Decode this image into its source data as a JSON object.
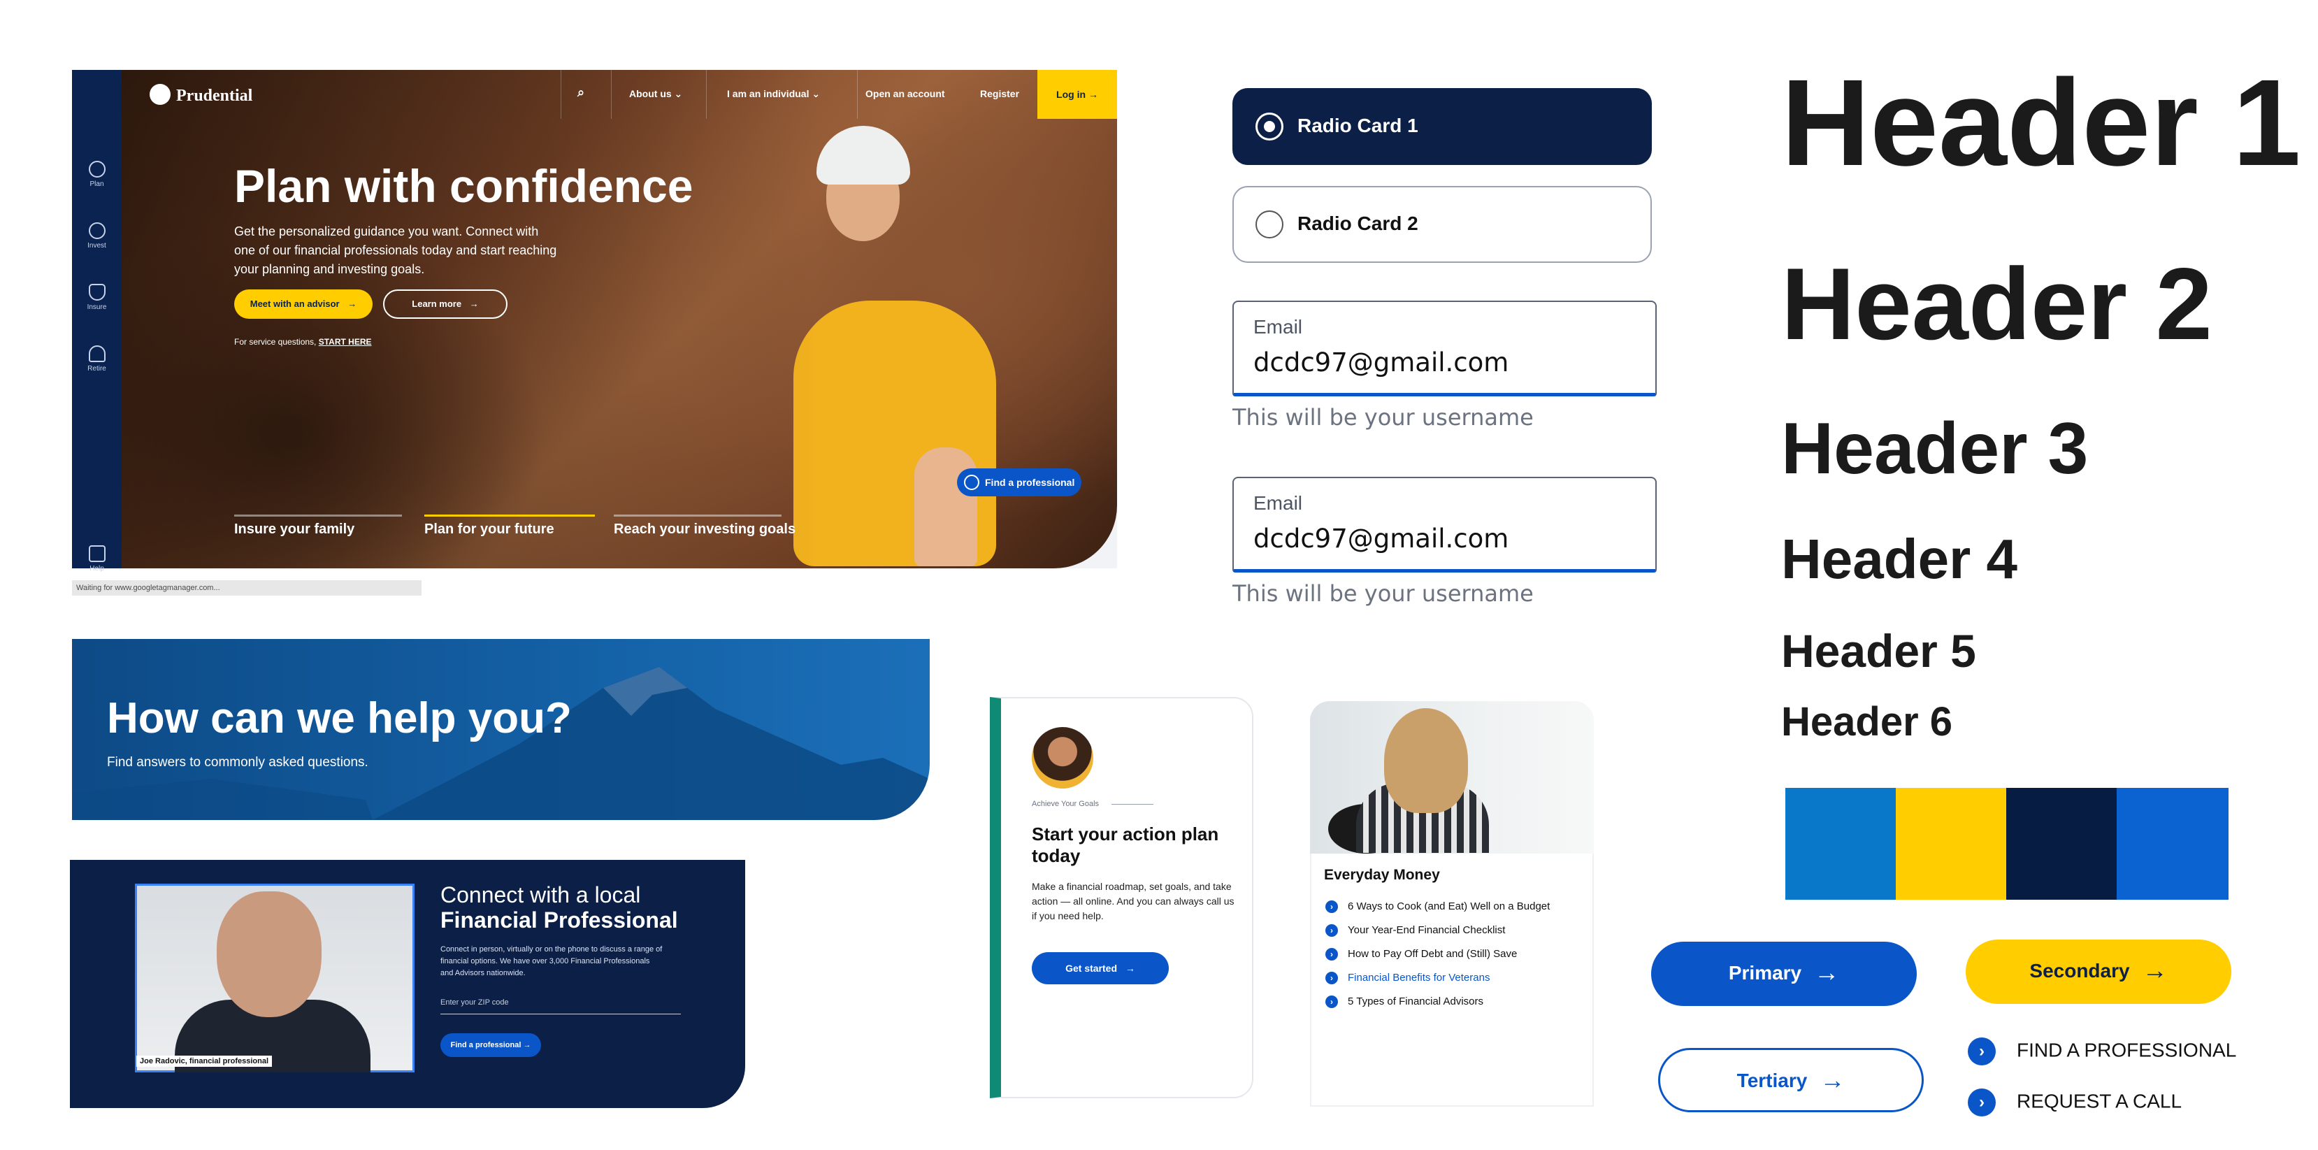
{
  "hero": {
    "rail_items": [
      "Plan",
      "Invest",
      "Insure",
      "Retire",
      "Help"
    ],
    "logo": "Prudential",
    "nav": [
      "About us",
      "I am an individual",
      "Open an account",
      "Register",
      "Log in"
    ],
    "title": "Plan with confidence",
    "body": "Get the personalized guidance you want. Connect with one of our financial professionals today and start reaching your planning and investing goals.",
    "primary_cta": "Meet with an advisor",
    "secondary_cta": "Learn more",
    "note_prefix": "For service questions,",
    "note_link": "START HERE",
    "tabs": [
      "Insure your family",
      "Plan for your future",
      "Reach your investing goals"
    ],
    "find_pro": "Find a professional",
    "status": "Waiting for www.googletagmanager.com..."
  },
  "radios": [
    {
      "label": "Radio Card 1",
      "selected": true
    },
    {
      "label": "Radio Card 2",
      "selected": false
    }
  ],
  "fields": [
    {
      "label": "Email",
      "value": "dcdc97@gmail.com",
      "helper": "This will be your username"
    },
    {
      "label": "Email",
      "value": "dcdc97@gmail.com",
      "helper": "This will be your username"
    }
  ],
  "headers": [
    "Header 1",
    "Header 2",
    "Header 3",
    "Header 4",
    "Header 5",
    "Header 6"
  ],
  "palette": [
    "#0a78c9",
    "#ffcd00",
    "#061c42",
    "#0a63d1"
  ],
  "buttons": {
    "primary": "Primary",
    "secondary": "Secondary",
    "tertiary": "Tertiary",
    "link1": "FIND A PROFESSIONAL",
    "link2": "REQUEST A CALL"
  },
  "help_banner": {
    "title": "How can we help you?",
    "subtitle": "Find answers to commonly asked questions."
  },
  "connect": {
    "title_line1": "Connect with a local",
    "title_line2": "Financial Professional",
    "body": "Connect in person, virtually or on the phone to discuss a range of financial options. We have over 3,000 Financial Professionals and Advisors nationwide.",
    "zip_placeholder": "Enter your ZIP code",
    "button": "Find a professional",
    "name_tag": "Joe Radovic, financial professional"
  },
  "action_card": {
    "eyebrow": "Achieve Your Goals",
    "title": "Start your action plan today",
    "body": "Make a financial roadmap, set goals, and take action — all online. And you can always call us if you need help.",
    "button": "Get started"
  },
  "money_card": {
    "title": "Everyday Money",
    "items": [
      "6 Ways to Cook (and Eat) Well on a Budget",
      "Your Year-End Financial Checklist",
      "How to Pay Off Debt and (Still) Save",
      "Financial Benefits for Veterans",
      "5 Types of Financial Advisors"
    ],
    "highlight_color": "#0a56c9"
  },
  "icons": {
    "arrow": "→",
    "chevron": "›",
    "search": "⌕",
    "caret": "⌄"
  }
}
